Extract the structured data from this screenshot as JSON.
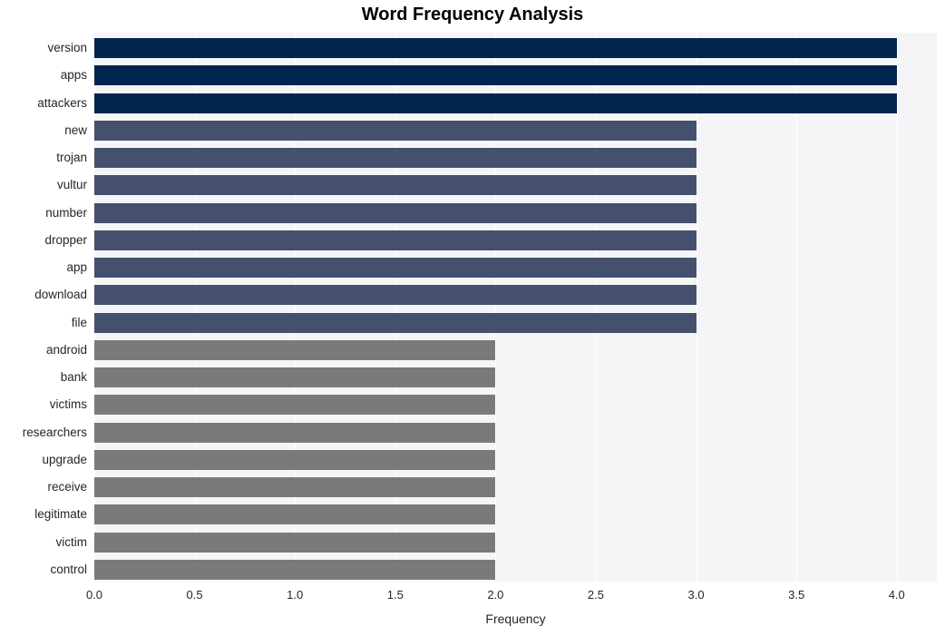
{
  "chart_data": {
    "type": "bar",
    "orientation": "horizontal",
    "title": "Word Frequency Analysis",
    "xlabel": "Frequency",
    "ylabel": "",
    "xlim": [
      0.0,
      4.2
    ],
    "xticks": [
      "0.0",
      "0.5",
      "1.0",
      "1.5",
      "2.0",
      "2.5",
      "3.0",
      "3.5",
      "4.0"
    ],
    "xtick_values": [
      0.0,
      0.5,
      1.0,
      1.5,
      2.0,
      2.5,
      3.0,
      3.5,
      4.0
    ],
    "grid": "vertical",
    "legend": "none",
    "categories": [
      "version",
      "apps",
      "attackers",
      "new",
      "trojan",
      "vultur",
      "number",
      "dropper",
      "app",
      "download",
      "file",
      "android",
      "bank",
      "victims",
      "researchers",
      "upgrade",
      "receive",
      "legitimate",
      "victim",
      "control"
    ],
    "values": [
      4,
      4,
      4,
      3,
      3,
      3,
      3,
      3,
      3,
      3,
      3,
      2,
      2,
      2,
      2,
      2,
      2,
      2,
      2,
      2
    ],
    "bar_colors": [
      "#01254e",
      "#01254e",
      "#01254e",
      "#45506e",
      "#45506e",
      "#45506e",
      "#45506e",
      "#45506e",
      "#45506e",
      "#45506e",
      "#45506e",
      "#7a7a78",
      "#7a7a78",
      "#7a7a78",
      "#7a7a78",
      "#7a7a78",
      "#7a7a78",
      "#7a7a78",
      "#7a7a78",
      "#7a7a78"
    ],
    "palette": {
      "high": "#01254e",
      "medium": "#45506e",
      "low": "#7a7a78",
      "plot_background": "#f5f5f7",
      "figure_background": "#ffffff",
      "gridline": "#ffffff",
      "text": "#262626"
    }
  }
}
